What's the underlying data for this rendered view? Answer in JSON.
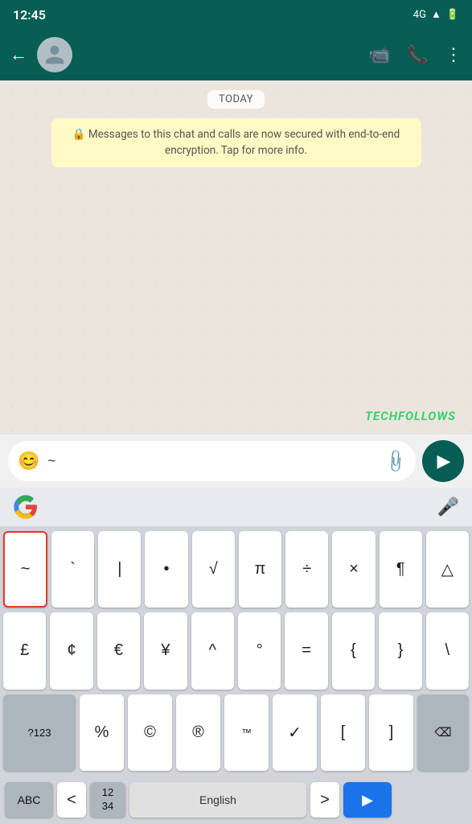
{
  "statusBar": {
    "time": "12:45",
    "signal": "4G"
  },
  "header": {
    "backLabel": "←",
    "title": "",
    "videoIcon": "🎥",
    "phoneIcon": "📞",
    "menuIcon": "⋮"
  },
  "chat": {
    "todayLabel": "TODAY",
    "encryptionNotice": "🔒 Messages to this chat and calls are now secured with end-to-end encryption. Tap for more info.",
    "watermark": "TECHFOLLOWS"
  },
  "inputBar": {
    "placeholder": "~",
    "emojiIcon": "😊",
    "attachIcon": "📎"
  },
  "keyboard": {
    "row1": [
      "~",
      "`",
      "|",
      "•",
      "√",
      "π",
      "÷",
      "×",
      "¶",
      "△"
    ],
    "row2": [
      "£",
      "¢",
      "€",
      "¥",
      "^",
      "°",
      "=",
      "{",
      "}",
      "\\"
    ],
    "row3Left": "?123",
    "row3": [
      "%",
      "©",
      "®",
      "™",
      "✓",
      "[",
      "]"
    ],
    "row3Right": "⌫",
    "row4Left": "ABC",
    "row4LeftArrow": "<",
    "row4Numbers": "12\n34",
    "row4Space": "English",
    "row4RightArrow": ">",
    "row4SendIcon": "▶"
  }
}
